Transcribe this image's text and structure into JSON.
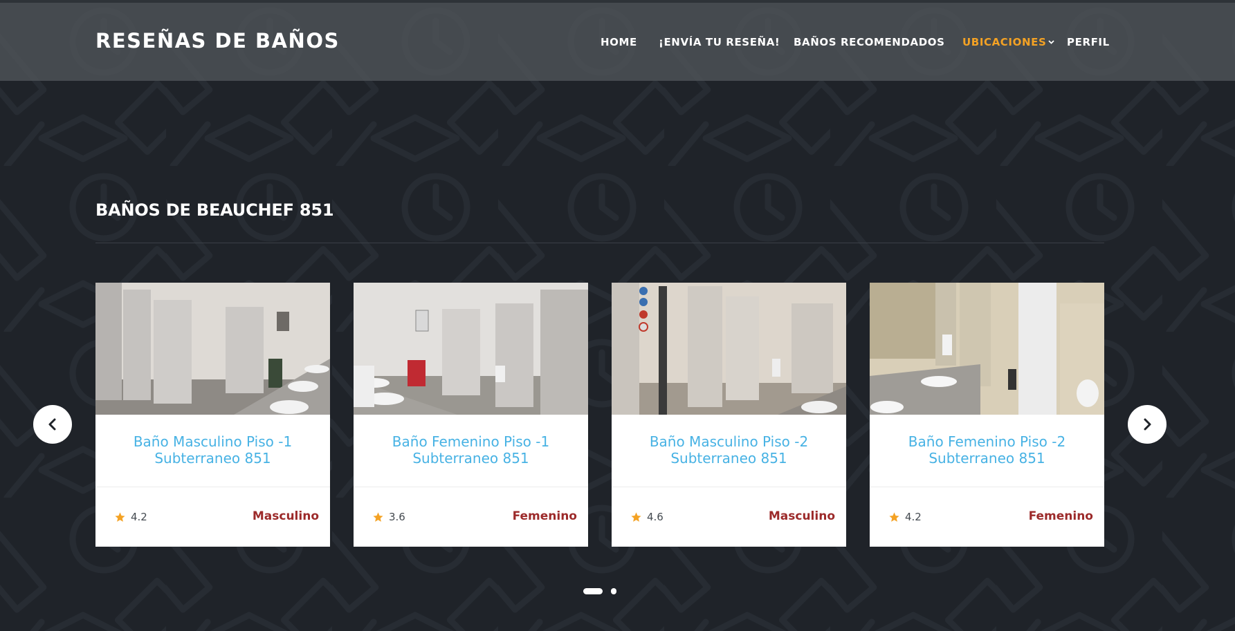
{
  "site": {
    "logo": "RESEÑAS DE BAÑOS"
  },
  "nav": {
    "items": [
      {
        "label": "HOME",
        "active": false
      },
      {
        "label": "¡ENVÍA TU RESEÑA!",
        "active": false
      },
      {
        "label": "BAÑOS RECOMENDADOS",
        "active": false
      },
      {
        "label": "UBICACIONES",
        "active": true,
        "icon": "chevron-down-icon"
      },
      {
        "label": "PERFIL",
        "active": false
      }
    ]
  },
  "section": {
    "title": "BAÑOS DE BEAUCHEF 851"
  },
  "cards": [
    {
      "title_line1": "Baño Masculino Piso -1",
      "title_line2": "Subterraneo 851",
      "rating": "4.2",
      "gender": "Masculino",
      "image": "photo-restroom-1"
    },
    {
      "title_line1": "Baño Femenino Piso -1",
      "title_line2": "Subterraneo 851",
      "rating": "3.6",
      "gender": "Femenino",
      "image": "photo-restroom-2"
    },
    {
      "title_line1": "Baño Masculino Piso -2",
      "title_line2": "Subterraneo 851",
      "rating": "4.6",
      "gender": "Masculino",
      "image": "photo-restroom-3"
    },
    {
      "title_line1": "Baño Femenino Piso -2",
      "title_line2": "Subterraneo 851",
      "rating": "4.2",
      "gender": "Femenino",
      "image": "photo-restroom-4"
    }
  ],
  "carousel": {
    "prev_icon": "chevron-left-icon",
    "next_icon": "chevron-right-icon",
    "pages": 2,
    "active_page": 1
  },
  "colors": {
    "background": "#1f2329",
    "accent": "#f4a224",
    "card_title": "#47b2e4",
    "gender_text": "#9c2a2a",
    "star": "#f4a224"
  }
}
